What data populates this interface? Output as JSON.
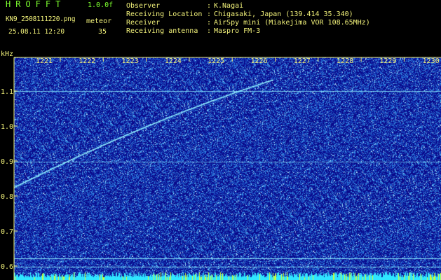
{
  "header": {
    "brand": "HROFFT",
    "version": "1.0.0f",
    "filename": "KN9_2508111220.png",
    "type_label": "meteor",
    "datetime": "25.08.11 12:20",
    "count": "35"
  },
  "info": [
    {
      "key": "Observer",
      "value": "K.Nagai"
    },
    {
      "key": "Receiving Location",
      "value": "Chigasaki, Japan (139.414 35.340)"
    },
    {
      "key": "Receiver",
      "value": "AirSpy mini (Miakejima VOR 108.65MHz)"
    },
    {
      "key": "Receiving antenna",
      "value": "Maspro FM-3"
    }
  ],
  "axis": {
    "unit": "kHz",
    "time_ticks": [
      "1221",
      "1222",
      "1223",
      "1224",
      "1225",
      "1226",
      "1227",
      "1228",
      "1229",
      "1230"
    ],
    "freq_ticks": [
      "1.1",
      "1.0",
      "0.9",
      "0.8",
      "0.7",
      "0.6"
    ]
  },
  "colors": {
    "background": "#0a0a8c",
    "noise": "#3a8fd8",
    "trace": "#8ff0ff",
    "label_yellow": "#F2F27A",
    "label_green": "#7CFF2E"
  }
}
